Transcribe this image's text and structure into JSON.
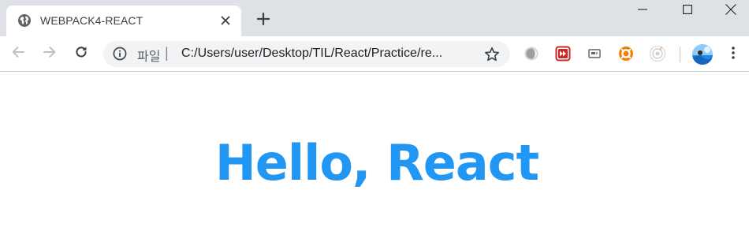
{
  "browser": {
    "tab": {
      "title": "WEBPACK4-REACT",
      "favicon_icon": "globe-icon"
    },
    "address_bar": {
      "scheme_label": "파일",
      "separator": "|",
      "url": "C:/Users/user/Desktop/TIL/React/Practice/re..."
    },
    "extensions": [
      "circle-extension-icon",
      "fast-forward-extension-icon",
      "screen-extension-icon",
      "lifebuoy-extension-icon",
      "target-extension-icon"
    ]
  },
  "page": {
    "heading": "Hello, React"
  },
  "colors": {
    "tabstrip_bg": "#dee1e6",
    "omnibox_bg": "#f1f3f4",
    "heading_color": "#2196f3"
  }
}
